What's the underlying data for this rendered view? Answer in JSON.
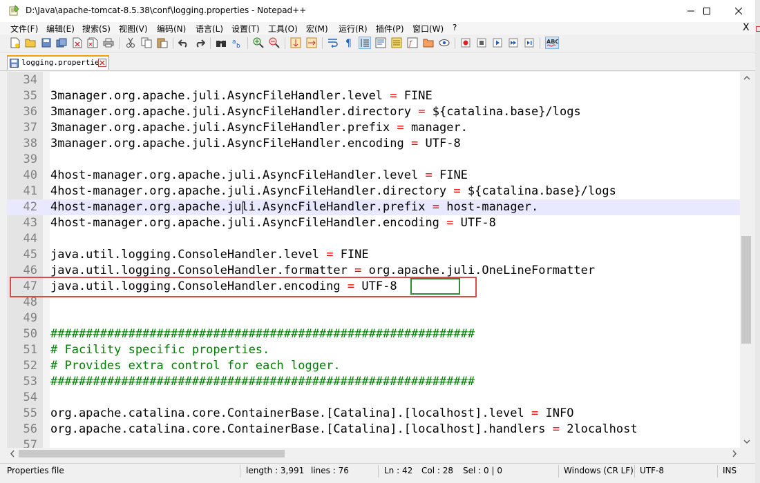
{
  "window": {
    "title": "D:\\Java\\apache-tomcat-8.5.38\\conf\\logging.properties - Notepad++"
  },
  "menu": [
    "文件(F)",
    "编辑(E)",
    "搜索(S)",
    "视图(V)",
    "编码(N)",
    "语言(L)",
    "设置(T)",
    "工具(O)",
    "宏(M)",
    "运行(R)",
    "插件(P)",
    "窗口(W)",
    "?"
  ],
  "menu_close": "X",
  "tab": {
    "label": "logging.properties"
  },
  "editor": {
    "lines": [
      {
        "n": "34",
        "text": ""
      },
      {
        "n": "35",
        "text": "3manager.org.apache.juli.AsyncFileHandler.level = FINE"
      },
      {
        "n": "36",
        "text": "3manager.org.apache.juli.AsyncFileHandler.directory = ${catalina.base}/logs"
      },
      {
        "n": "37",
        "text": "3manager.org.apache.juli.AsyncFileHandler.prefix = manager."
      },
      {
        "n": "38",
        "text": "3manager.org.apache.juli.AsyncFileHandler.encoding = UTF-8"
      },
      {
        "n": "39",
        "text": ""
      },
      {
        "n": "40",
        "text": "4host-manager.org.apache.juli.AsyncFileHandler.level = FINE"
      },
      {
        "n": "41",
        "text": "4host-manager.org.apache.juli.AsyncFileHandler.directory = ${catalina.base}/logs"
      },
      {
        "n": "42",
        "text": "4host-manager.org.apache.juli.AsyncFileHandler.prefix = host-manager."
      },
      {
        "n": "43",
        "text": "4host-manager.org.apache.juli.AsyncFileHandler.encoding = UTF-8"
      },
      {
        "n": "44",
        "text": ""
      },
      {
        "n": "45",
        "text": "java.util.logging.ConsoleHandler.level = FINE"
      },
      {
        "n": "46",
        "text": "java.util.logging.ConsoleHandler.formatter = org.apache.juli.OneLineFormatter"
      },
      {
        "n": "47",
        "text": "java.util.logging.ConsoleHandler.encoding = UTF-8"
      },
      {
        "n": "48",
        "text": ""
      },
      {
        "n": "49",
        "text": ""
      },
      {
        "n": "50",
        "text": "############################################################"
      },
      {
        "n": "51",
        "text": "# Facility specific properties."
      },
      {
        "n": "52",
        "text": "# Provides extra control for each logger."
      },
      {
        "n": "53",
        "text": "############################################################"
      },
      {
        "n": "54",
        "text": ""
      },
      {
        "n": "55",
        "text": "org.apache.catalina.core.ContainerBase.[Catalina].[localhost].level = INFO"
      },
      {
        "n": "56",
        "text": "org.apache.catalina.core.ContainerBase.[Catalina].[localhost].handlers = 2localhost"
      },
      {
        "n": "57",
        "text": ""
      }
    ],
    "current_line": "42"
  },
  "status": {
    "file_type": "Properties file",
    "length": "length : 3,991",
    "lines": "lines : 76",
    "ln": "Ln : 42",
    "col": "Col : 28",
    "sel": "Sel : 0 | 0",
    "eol": "Windows (CR LF)",
    "encoding": "UTF-8",
    "mode": "INS"
  },
  "colors": {
    "operator": "#ff0000",
    "comment": "#008000",
    "highlight_red": "#e04848",
    "highlight_green": "#2f8a3a"
  }
}
